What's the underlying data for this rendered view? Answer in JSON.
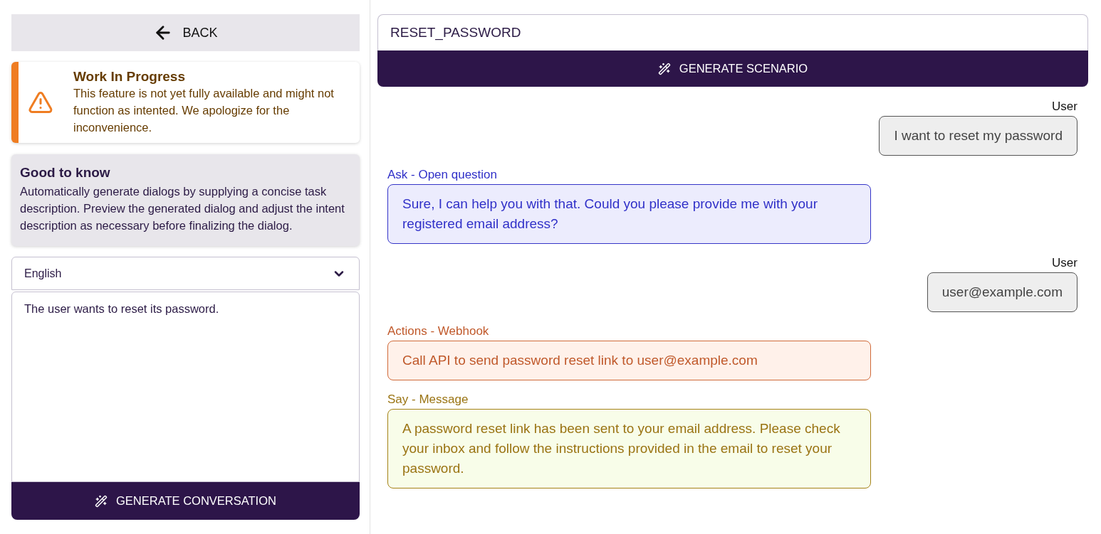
{
  "back_button": {
    "label": "BACK"
  },
  "notice": {
    "title": "Work In Progress",
    "text": "This feature is not yet fully available and might not function as intented. We apologize for the inconvenience."
  },
  "info": {
    "title": "Good to know",
    "text": "Automatically generate dialogs by supplying a concise task description. Preview the generated dialog and adjust the intent description as necessary before finalizing the dialog."
  },
  "language_select": {
    "value": "English"
  },
  "description": {
    "value": "The user wants to reset its password."
  },
  "generate_conversation_button": {
    "label": "GENERATE CONVERSATION"
  },
  "intent": {
    "value": "RESET_PASSWORD"
  },
  "generate_scenario_button": {
    "label": "GENERATE SCENARIO"
  },
  "conversation": [
    {
      "kind": "user",
      "label": "User",
      "text": "I want to reset my password"
    },
    {
      "kind": "ask",
      "label": "Ask - Open question",
      "text": "Sure, I can help you with that. Could you please provide me with your registered email address?"
    },
    {
      "kind": "user",
      "label": "User",
      "text": "user@example.com"
    },
    {
      "kind": "webhook",
      "label": "Actions - Webhook",
      "text": "Call API to send password reset link to user@example.com"
    },
    {
      "kind": "say",
      "label": "Say - Message",
      "text": "A password reset link has been sent to your email address. Please check your inbox and follow the instructions provided in the email to reset your password."
    }
  ]
}
